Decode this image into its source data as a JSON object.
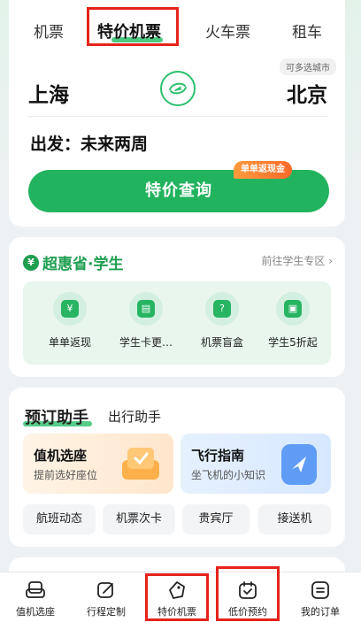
{
  "booking": {
    "tabs": [
      "机票",
      "特价机票",
      "火车票",
      "租车"
    ],
    "active_tab": "特价机票",
    "multi_city_tag": "可多选城市",
    "from_city": "上海",
    "to_city": "北京",
    "departure": "出发：未来两周",
    "search_button": "特价查询",
    "cashback_tag": "单单返现金"
  },
  "student": {
    "brand": "超惠省·学生",
    "brand_icon": "money-bag-icon",
    "link": "前往学生专区 ›",
    "perks": [
      {
        "label": "单单返现",
        "icon": "money-bag-icon"
      },
      {
        "label": "学生卡更…",
        "icon": "student-card-icon"
      },
      {
        "label": "机票盲盒",
        "icon": "mystery-box-icon"
      },
      {
        "label": "学生5折起",
        "icon": "train-icon"
      }
    ]
  },
  "helper": {
    "tabs": [
      "预订助手",
      "出行助手"
    ],
    "features": [
      {
        "title": "值机选座",
        "subtitle": "提前选好座位",
        "icon": "seat-icon"
      },
      {
        "title": "飞行指南",
        "subtitle": "坐飞机的小知识",
        "icon": "compass-icon"
      }
    ],
    "quick_links": [
      "航班动态",
      "机票次卡",
      "贵宾厅",
      "接送机"
    ]
  },
  "bottom_nav": [
    {
      "label": "值机选座",
      "icon": "seat-icon"
    },
    {
      "label": "行程定制",
      "icon": "edit-icon"
    },
    {
      "label": "特价机票",
      "icon": "tag-icon"
    },
    {
      "label": "低价预约",
      "icon": "calendar-check-icon"
    },
    {
      "label": "我的订单",
      "icon": "order-list-icon"
    }
  ],
  "colors": {
    "accent_green": "#22b35e",
    "highlight_red": "#e5231b",
    "cashback_orange": "#ff7a2f"
  }
}
